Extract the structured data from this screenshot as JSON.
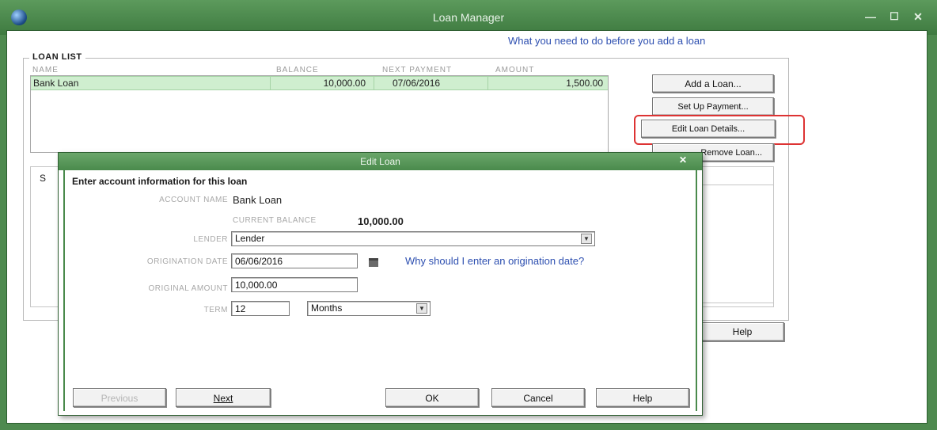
{
  "window": {
    "title": "Loan Manager",
    "minimize": "—",
    "maximize": "☐",
    "close": "✕"
  },
  "help_link": "What you need to do before you add a loan",
  "loan_list": {
    "legend": "LOAN LIST",
    "columns": [
      "NAME",
      "BALANCE",
      "NEXT PAYMENT",
      "AMOUNT"
    ],
    "rows": [
      {
        "name": "Bank Loan",
        "balance": "10,000.00",
        "next_payment": "07/06/2016",
        "amount": "1,500.00"
      }
    ]
  },
  "side_buttons": {
    "add": "Add a Loan...",
    "setup": "Set Up Payment...",
    "edit": "Edit Loan Details...",
    "remove": "Remove Loan..."
  },
  "help_button": "Help",
  "partial_labels": {
    "summary_s": "S"
  },
  "dialog": {
    "title": "Edit Loan",
    "close": "✕",
    "heading": "Enter account information for this loan",
    "account_name_label": "ACCOUNT NAME",
    "account_name": "Bank Loan",
    "current_balance_label": "CURRENT BALANCE",
    "current_balance": "10,000.00",
    "lender_label": "LENDER",
    "lender": "Lender",
    "origination_label": "ORIGINATION DATE",
    "origination_date": "06/06/2016",
    "origination_link": "Why should I enter an origination date?",
    "original_amount_label": "ORIGINAL AMOUNT",
    "original_amount": "10,000.00",
    "term_label": "TERM",
    "term": "12",
    "term_unit": "Months",
    "buttons": {
      "previous": "Previous",
      "next": "Next",
      "ok": "OK",
      "cancel": "Cancel",
      "help": "Help"
    }
  },
  "colors": {
    "title_bar": "#4e8a4f",
    "selection": "#cfeecf",
    "link": "#2d4fb0",
    "highlight": "#dd3333"
  }
}
